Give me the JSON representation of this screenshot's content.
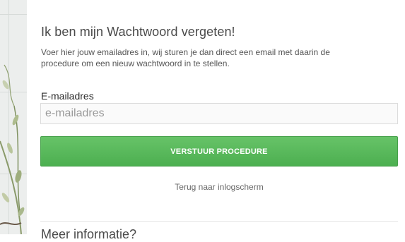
{
  "page": {
    "title": "Ik ben mijn Wachtwoord vergeten!",
    "description": "Voer hier jouw emailadres in, wij sturen je dan direct een email met daarin de procedure om een nieuw wachtwoord in te stellen."
  },
  "form": {
    "email_label": "E-mailadres",
    "email_placeholder": "e-mailadres",
    "email_value": "",
    "submit_label": "VERSTUUR PROCEDURE",
    "back_link": "Terug naar inlogscherm"
  },
  "more_info": {
    "heading": "Meer informatie?"
  },
  "colors": {
    "submit_green": "#5cb85c",
    "text_dark": "#4a4a4a"
  },
  "icons": {
    "background_decoration": "plant-illustration"
  }
}
